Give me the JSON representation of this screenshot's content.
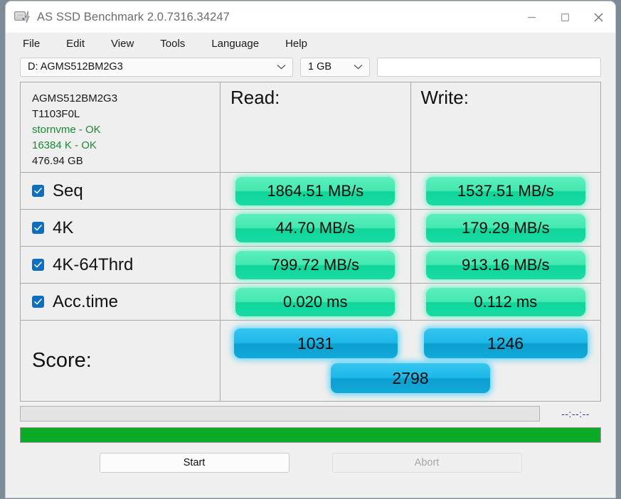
{
  "window": {
    "title": "AS SSD Benchmark 2.0.7316.34247",
    "icon": "ssd-drive-icon",
    "controls": {
      "minimize": "minimize-icon",
      "maximize": "maximize-icon",
      "close": "close-icon"
    }
  },
  "menu": {
    "items": [
      {
        "label": "File"
      },
      {
        "label": "Edit"
      },
      {
        "label": "View"
      },
      {
        "label": "Tools"
      },
      {
        "label": "Language"
      },
      {
        "label": "Help"
      }
    ]
  },
  "toolbar": {
    "drive_select": "D: AGMS512BM2G3",
    "size_select": "1 GB",
    "name_field_value": "",
    "name_field_placeholder": ""
  },
  "drive_info": {
    "model": "AGMS512BM2G3",
    "firmware": "T1103F0L",
    "driver": "stornvme - OK",
    "alignment": "16384 K - OK",
    "capacity": "476.94 GB"
  },
  "columns": {
    "read": "Read:",
    "write": "Write:"
  },
  "tests": [
    {
      "name": "Seq",
      "checked": true,
      "read": "1864.51 MB/s",
      "write": "1537.51 MB/s"
    },
    {
      "name": "4K",
      "checked": true,
      "read": "44.70 MB/s",
      "write": "179.29 MB/s"
    },
    {
      "name": "4K-64Thrd",
      "checked": true,
      "read": "799.72 MB/s",
      "write": "913.16 MB/s"
    },
    {
      "name": "Acc.time",
      "checked": true,
      "read": "0.020 ms",
      "write": "0.112 ms"
    }
  ],
  "score": {
    "label": "Score:",
    "read": "1031",
    "write": "1246",
    "total": "2798"
  },
  "status": {
    "message": "",
    "timer": "--:--:--",
    "progress_percent": 100
  },
  "actions": {
    "start": "Start",
    "abort": "Abort"
  },
  "colors": {
    "badge_green": "#18dba4",
    "badge_blue": "#0c9fd0",
    "progress_green": "#0cab27",
    "ok_text": "#1a8a34",
    "checkbox_blue": "#0d6fc0"
  },
  "chart_data": {
    "type": "table",
    "title": "AS SSD Benchmark 2.0.7316.34247",
    "categories": [
      "Seq",
      "4K",
      "4K-64Thrd",
      "Acc.time"
    ],
    "series": [
      {
        "name": "Read",
        "values": [
          1864.51,
          44.7,
          799.72,
          0.02
        ],
        "units": [
          "MB/s",
          "MB/s",
          "MB/s",
          "ms"
        ]
      },
      {
        "name": "Write",
        "values": [
          1537.51,
          179.29,
          913.16,
          0.112
        ],
        "units": [
          "MB/s",
          "MB/s",
          "MB/s",
          "ms"
        ]
      }
    ],
    "scores": {
      "read": 1031,
      "write": 1246,
      "total": 2798
    },
    "drive": "AGMS512BM2G3",
    "test_size": "1 GB"
  }
}
